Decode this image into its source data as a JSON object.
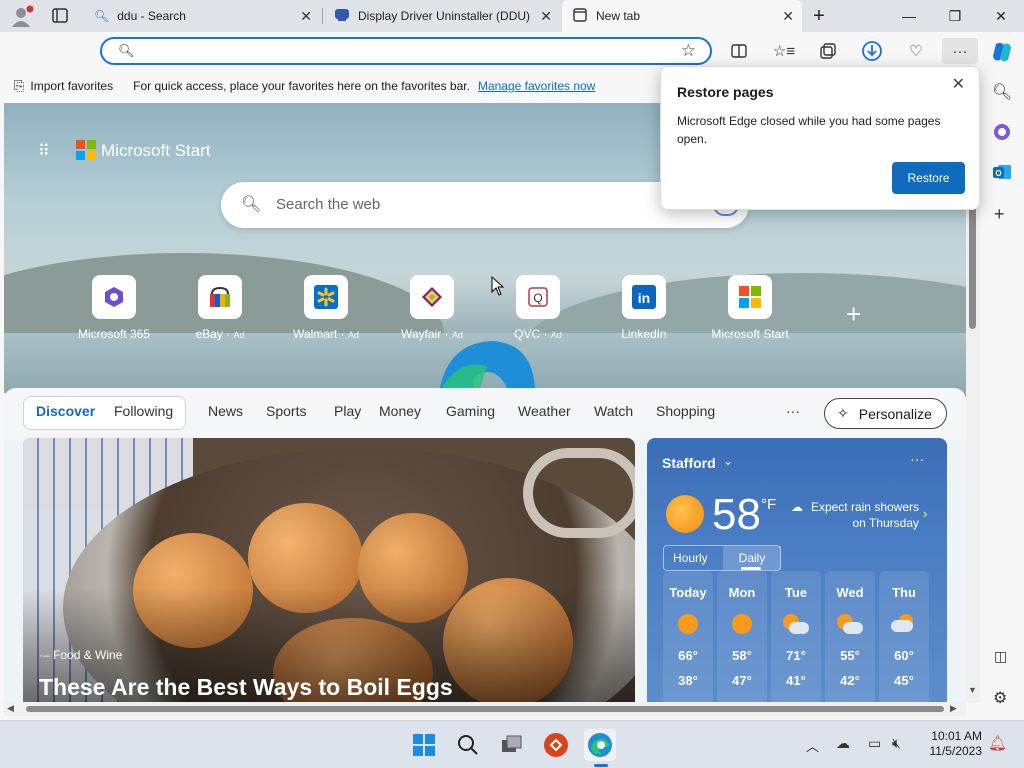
{
  "tabs": [
    {
      "title": "ddu - Search"
    },
    {
      "title": "Display Driver Uninstaller (DDU)"
    },
    {
      "title": "New tab"
    }
  ],
  "favbar": {
    "import_label": "Import favorites",
    "hint": "For quick access, place your favorites here on the favorites bar.",
    "manage_link": "Manage favorites now"
  },
  "start": {
    "brand": "Microsoft Start",
    "search_placeholder": "Search the web"
  },
  "tiles": [
    {
      "label": "Microsoft 365",
      "ad": ""
    },
    {
      "label": "eBay",
      "ad": "Ad"
    },
    {
      "label": "Walmart",
      "ad": "Ad"
    },
    {
      "label": "Wayfair",
      "ad": "Ad"
    },
    {
      "label": "QVC",
      "ad": "Ad"
    },
    {
      "label": "LinkedIn",
      "ad": ""
    },
    {
      "label": "Microsoft Start",
      "ad": ""
    }
  ],
  "nav": {
    "discover": "Discover",
    "following": "Following",
    "items": [
      "News",
      "Sports",
      "Play",
      "Money",
      "Gaming",
      "Weather",
      "Watch",
      "Shopping"
    ],
    "more": "···",
    "personalize": "Personalize"
  },
  "news": {
    "source": "Food & Wine",
    "headline": "These Are the Best Ways to Boil Eggs"
  },
  "weather": {
    "location": "Stafford",
    "temp": "58",
    "unit": "°F",
    "alert": "Expect rain showers on Thursday",
    "tab_hourly": "Hourly",
    "tab_daily": "Daily",
    "days": [
      {
        "name": "Today",
        "hi": "66°",
        "lo": "38°",
        "icon": "sun-icon"
      },
      {
        "name": "Mon",
        "hi": "58°",
        "lo": "47°",
        "icon": "sun-icon"
      },
      {
        "name": "Tue",
        "hi": "71°",
        "lo": "41°",
        "icon": "partly-cloudy-icon"
      },
      {
        "name": "Wed",
        "hi": "55°",
        "lo": "42°",
        "icon": "partly-cloudy-icon"
      },
      {
        "name": "Thu",
        "hi": "60°",
        "lo": "45°",
        "icon": "rain-icon"
      }
    ]
  },
  "popup": {
    "title": "Restore pages",
    "body": "Microsoft Edge closed while you had some pages open.",
    "button": "Restore"
  },
  "clock": {
    "time": "10:01 AM",
    "date": "11/5/2023"
  },
  "colors": {
    "accent": "#0f6cbd",
    "edge_blue": "#1a73d6"
  }
}
